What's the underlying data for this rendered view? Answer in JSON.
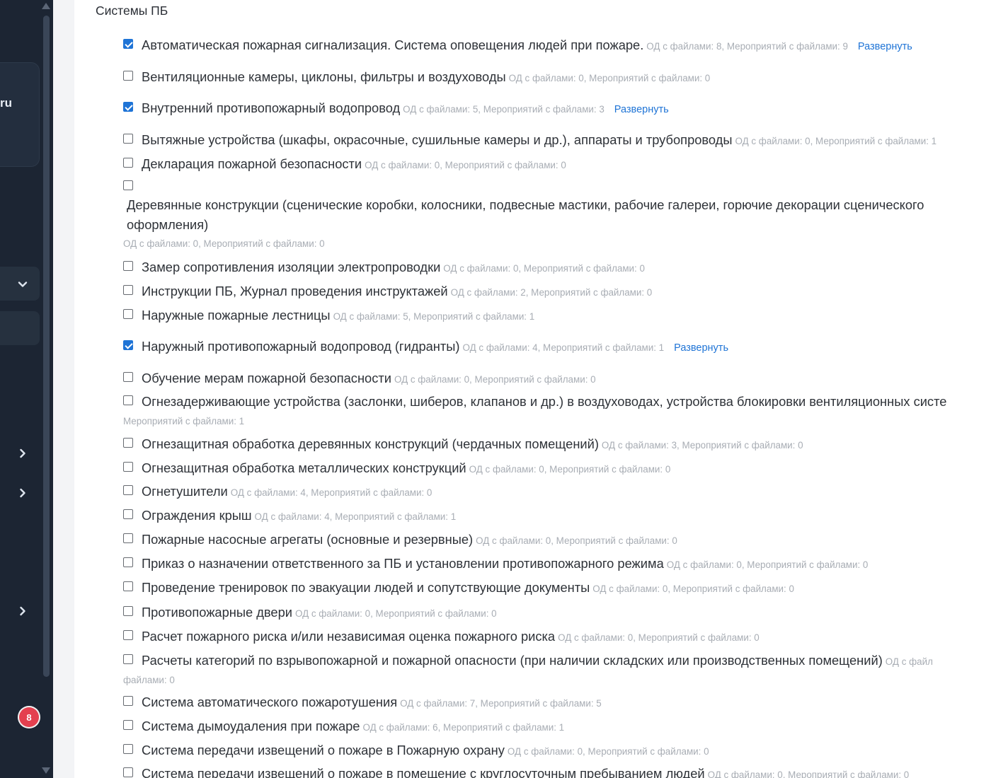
{
  "sidebar": {
    "brand_fragment": "ru",
    "notification_count": "8"
  },
  "section_title": "Системы ПБ",
  "expand_label": "Развернуть",
  "items": [
    {
      "label": "Автоматическая пожарная сигнализация. Система оповещения людей при пожаре.",
      "meta": "ОД с файлами: 8, Мероприятий с файлами: 9",
      "checked": true,
      "expandable": true
    },
    {
      "label": "Вентиляционные камеры, циклоны, фильтры и воздуховоды",
      "meta": "ОД с файлами: 0, Мероприятий с файлами: 0",
      "checked": false,
      "expandable": false
    },
    {
      "label": "Внутренний противопожарный водопровод",
      "meta": "ОД с файлами: 5, Мероприятий с файлами: 3",
      "checked": true,
      "expandable": true
    },
    {
      "label": "Вытяжные устройства (шкафы, окрасочные, сушильные камеры и др.), аппараты и трубопроводы",
      "meta": "ОД с файлами: 0, Мероприятий с файлами: 1",
      "checked": false,
      "expandable": false
    },
    {
      "label": "Декларация пожарной безопасности",
      "meta": "ОД с файлами: 0, Мероприятий с файлами: 0",
      "checked": false,
      "expandable": false
    },
    {
      "label_line1": "Деревянные конструкции (сценические коробки, колосники, подвесные мастики, рабочие галереи, горючие декорации сценического",
      "label_line2": "оформления)",
      "meta": "ОД с файлами: 0, Мероприятий с файлами: 0",
      "checked": false,
      "expandable": false
    },
    {
      "label": "Замер сопротивления изоляции электропроводки",
      "meta": "ОД с файлами: 0, Мероприятий с файлами: 0",
      "checked": false,
      "expandable": false
    },
    {
      "label": "Инструкции ПБ, Журнал проведения инструктажей",
      "meta": "ОД с файлами: 2, Мероприятий с файлами: 0",
      "checked": false,
      "expandable": false
    },
    {
      "label": "Наружные пожарные лестницы",
      "meta": "ОД с файлами: 5, Мероприятий с файлами: 1",
      "checked": false,
      "expandable": false
    },
    {
      "label": "Наружный противопожарный водопровод (гидранты)",
      "meta": "ОД с файлами: 4, Мероприятий с файлами: 1",
      "checked": true,
      "expandable": true
    },
    {
      "label": "Обучение мерам пожарной безопасности",
      "meta": "ОД с файлами: 0, Мероприятий с файлами: 0",
      "checked": false,
      "expandable": false
    },
    {
      "label": "Огнезадерживающие устройства (заслонки, шиберов, клапанов и др.) в воздуховодах, устройства блокировки вентиляционных систе",
      "meta_line2": "Мероприятий с файлами: 1",
      "checked": false,
      "expandable": false
    },
    {
      "label": "Огнезащитная обработка деревянных конструкций (чердачных помещений)",
      "meta": "ОД с файлами: 3, Мероприятий с файлами: 0",
      "checked": false,
      "expandable": false
    },
    {
      "label": "Огнезащитная обработка металлических конструкций",
      "meta": "ОД с файлами: 0, Мероприятий с файлами: 0",
      "checked": false,
      "expandable": false
    },
    {
      "label": "Огнетушители",
      "meta": "ОД с файлами: 4, Мероприятий с файлами: 0",
      "checked": false,
      "expandable": false
    },
    {
      "label": "Ограждения крыш",
      "meta": "ОД с файлами: 4, Мероприятий с файлами: 1",
      "checked": false,
      "expandable": false
    },
    {
      "label": "Пожарные насосные агрегаты (основные и резервные)",
      "meta": "ОД с файлами: 0, Мероприятий с файлами: 0",
      "checked": false,
      "expandable": false
    },
    {
      "label": "Приказ о назначении ответственного за ПБ и установлении противопожарного режима",
      "meta": "ОД с файлами: 0, Мероприятий с файлами: 0",
      "checked": false,
      "expandable": false
    },
    {
      "label": "Проведение тренировок по эвакуации людей и сопутствующие документы",
      "meta": "ОД с файлами: 0, Мероприятий с файлами: 0",
      "checked": false,
      "expandable": false
    },
    {
      "label": "Противопожарные двери",
      "meta": "ОД с файлами: 0, Мероприятий с файлами: 0",
      "checked": false,
      "expandable": false
    },
    {
      "label": "Расчет пожарного риска и/или независимая оценка пожарного риска",
      "meta": "ОД с файлами: 0, Мероприятий с файлами: 0",
      "checked": false,
      "expandable": false
    },
    {
      "label": "Расчеты категорий по взрывопожарной и пожарной опасности (при наличии складских или производственных помещений)",
      "meta": "ОД с файл",
      "meta_line2": "файлами: 0",
      "checked": false,
      "expandable": false
    },
    {
      "label": "Система автоматического пожаротушения",
      "meta": "ОД с файлами: 7, Мероприятий с файлами: 5",
      "checked": false,
      "expandable": false
    },
    {
      "label": "Система дымоудаления при пожаре",
      "meta": "ОД с файлами: 6, Мероприятий с файлами: 1",
      "checked": false,
      "expandable": false
    },
    {
      "label": "Система передачи извещений о пожаре в Пожарную охрану",
      "meta": "ОД с файлами: 0, Мероприятий с файлами: 0",
      "checked": false,
      "expandable": false
    },
    {
      "label": "Система передачи извещений о пожаре в помещение с круглосуточным пребыванием людей",
      "meta": "ОД с файлами: 0, Мероприятий с файлами: 0",
      "checked": false,
      "expandable": false
    }
  ]
}
